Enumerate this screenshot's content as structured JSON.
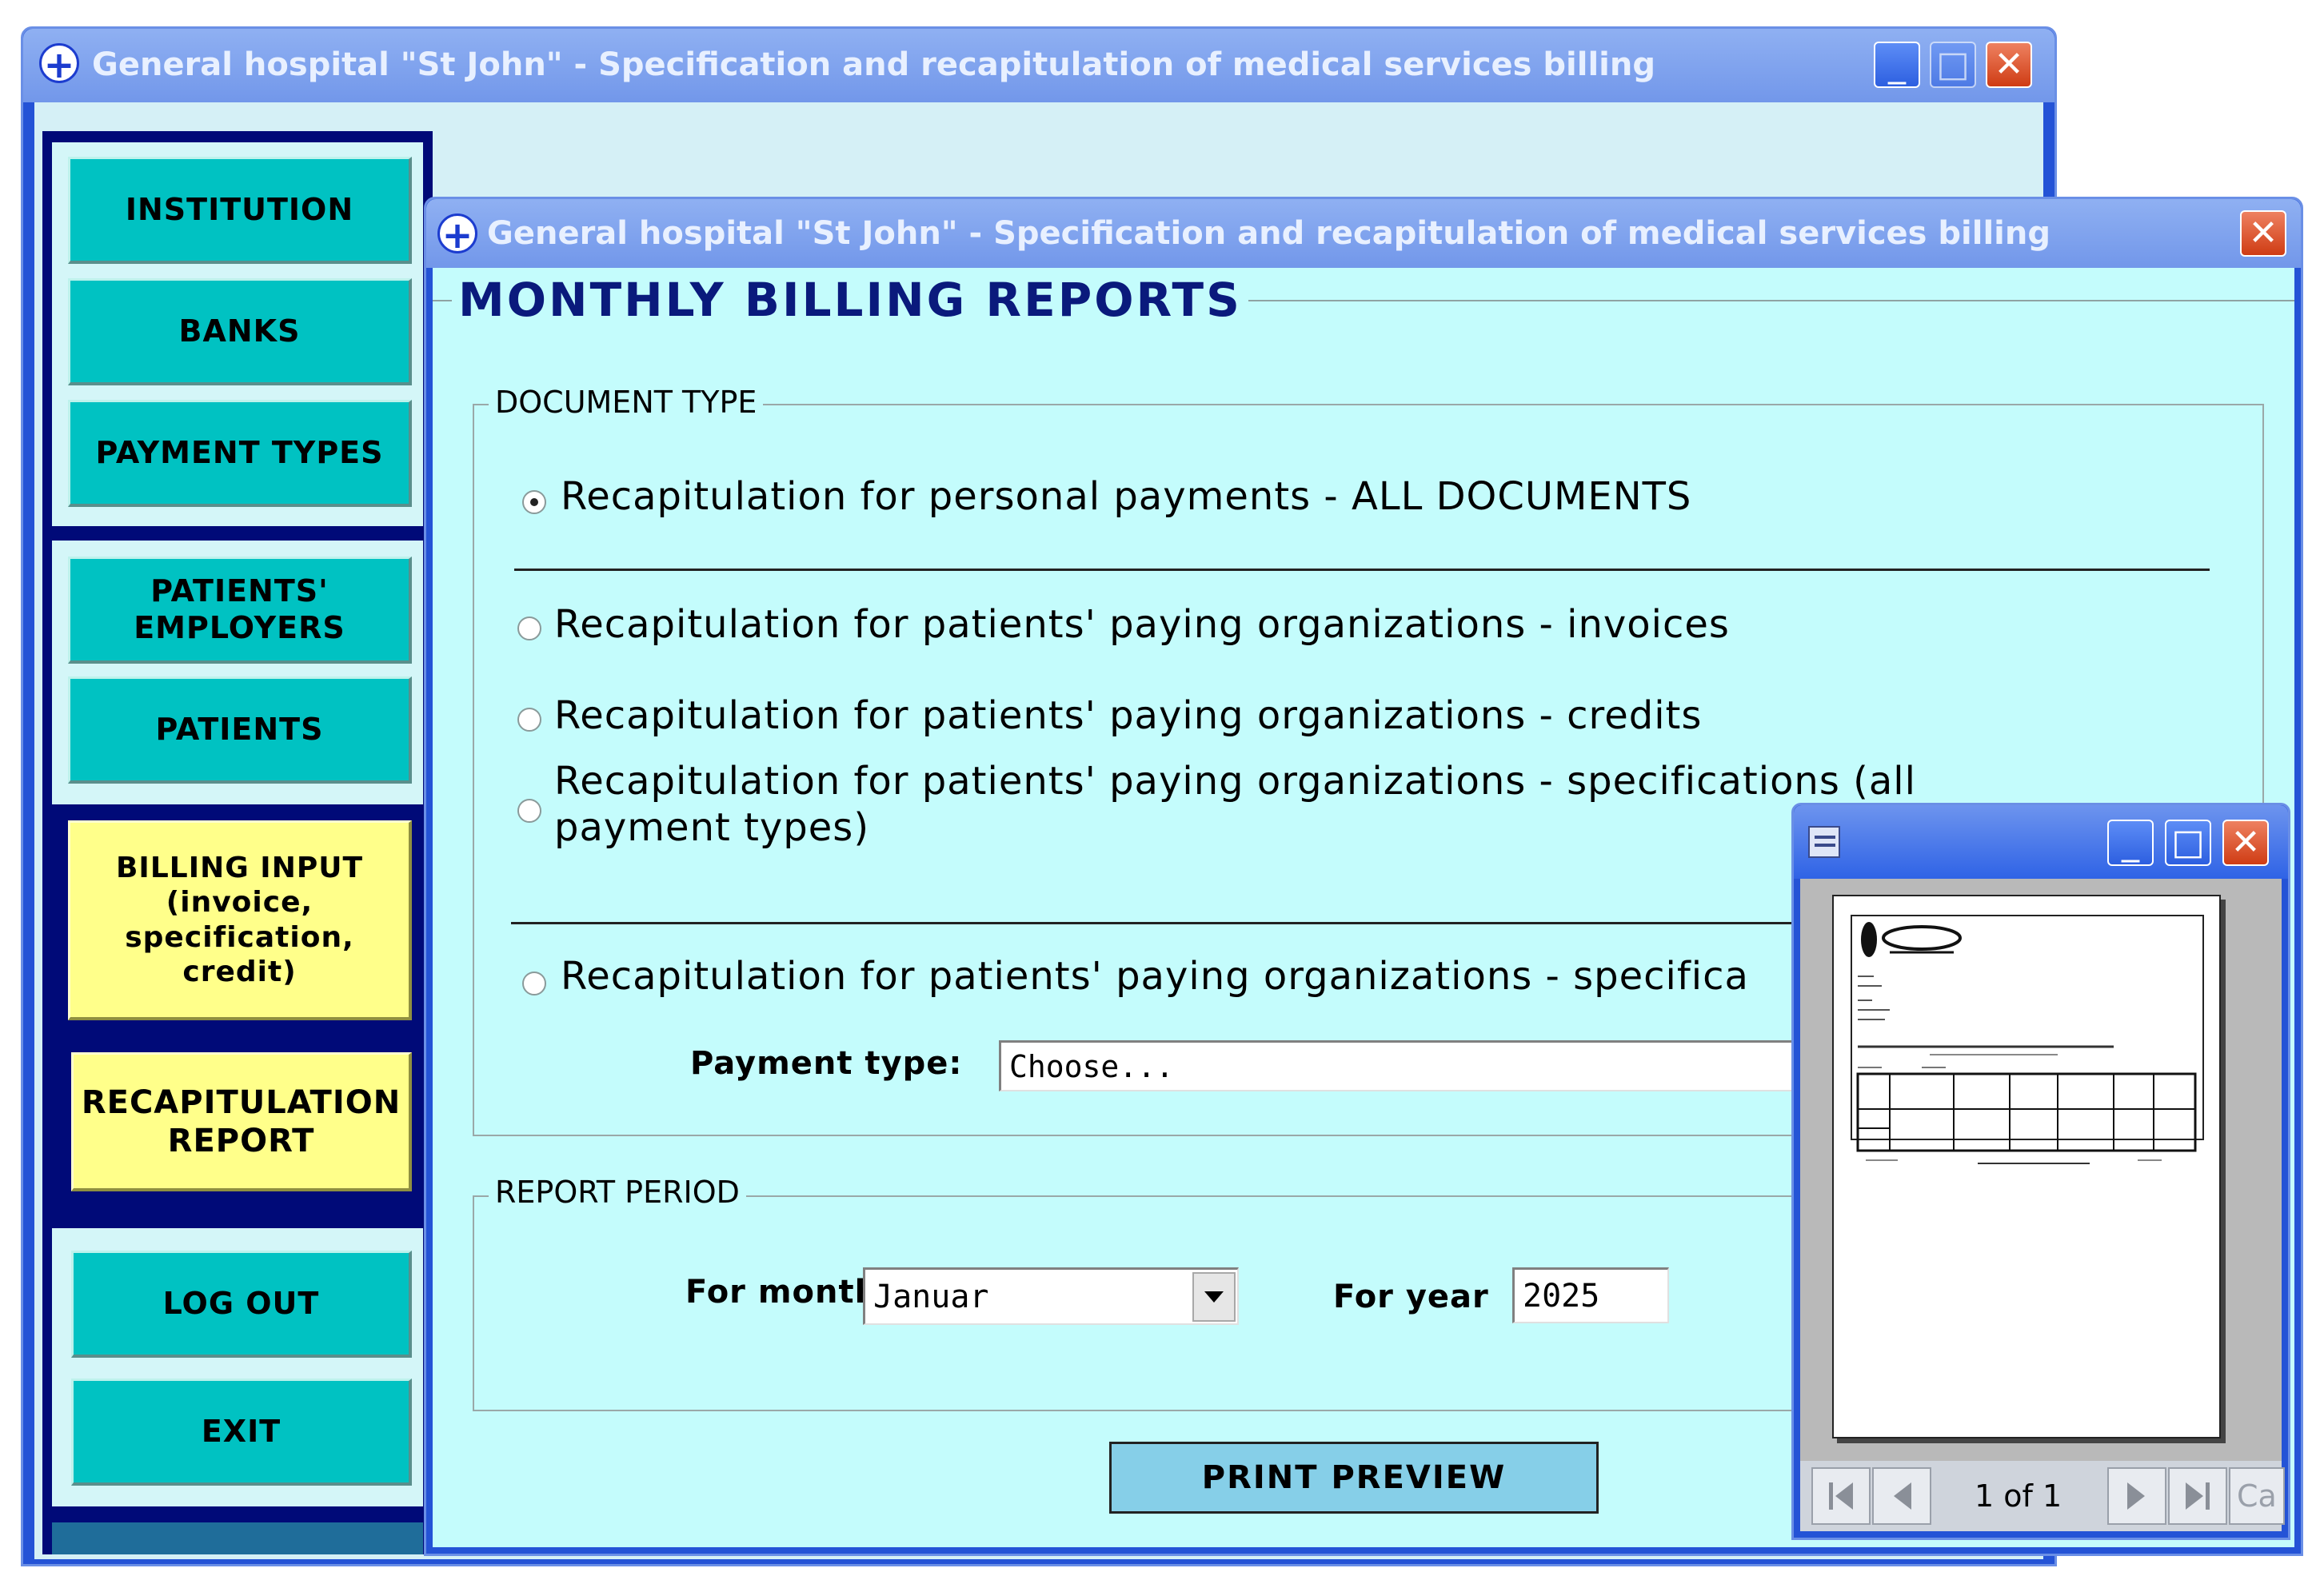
{
  "main_window": {
    "title": "General hospital \"St John\" - Specification and recapitulation of medical services billing",
    "controls": {
      "minimize": "_",
      "maximize": "□",
      "close": "✕"
    }
  },
  "sidebar": {
    "group1": [
      "INSTITUTION",
      "BANKS",
      "PAYMENT TYPES"
    ],
    "group2": [
      "PATIENTS' EMPLOYERS",
      "PATIENTS"
    ],
    "group3": [
      "BILLING INPUT (invoice, specification, credit)",
      "RECAPITULATION REPORT"
    ],
    "group4": [
      "LOG OUT",
      "EXIT"
    ]
  },
  "report_window": {
    "title": "General hospital \"St John\" - Specification and recapitulation of medical services billing",
    "close": "✕",
    "heading": "MONTHLY BILLING REPORTS",
    "document_type": {
      "caption": "DOCUMENT TYPE",
      "options": [
        {
          "label": "Recapitulation for personal payments - ALL DOCUMENTS",
          "checked": true
        },
        {
          "label": "Recapitulation for patients' paying organizations  - invoices",
          "checked": false
        },
        {
          "label": "Recapitulation for patients' paying organizations - credits",
          "checked": false
        },
        {
          "label_line1": "Recapitulation for patients' paying organizations - specifications (all",
          "label_line2": "payment types)",
          "checked": false
        },
        {
          "label": "Recapitulation for patients' paying organizations - specifica",
          "checked": false
        }
      ],
      "payment_type_label": "Payment type:",
      "payment_type_value": "Choose..."
    },
    "report_period": {
      "caption": "REPORT PERIOD",
      "month_label": "For month",
      "month_value": "Januar",
      "year_label": "For year",
      "year_value": "2025"
    },
    "print_preview_label": "PRINT PREVIEW"
  },
  "preview_window": {
    "controls": {
      "minimize": "_",
      "maximize": "□",
      "close": "✕"
    },
    "page_counter": "1 of 1",
    "cancel_partial": "Ca"
  }
}
